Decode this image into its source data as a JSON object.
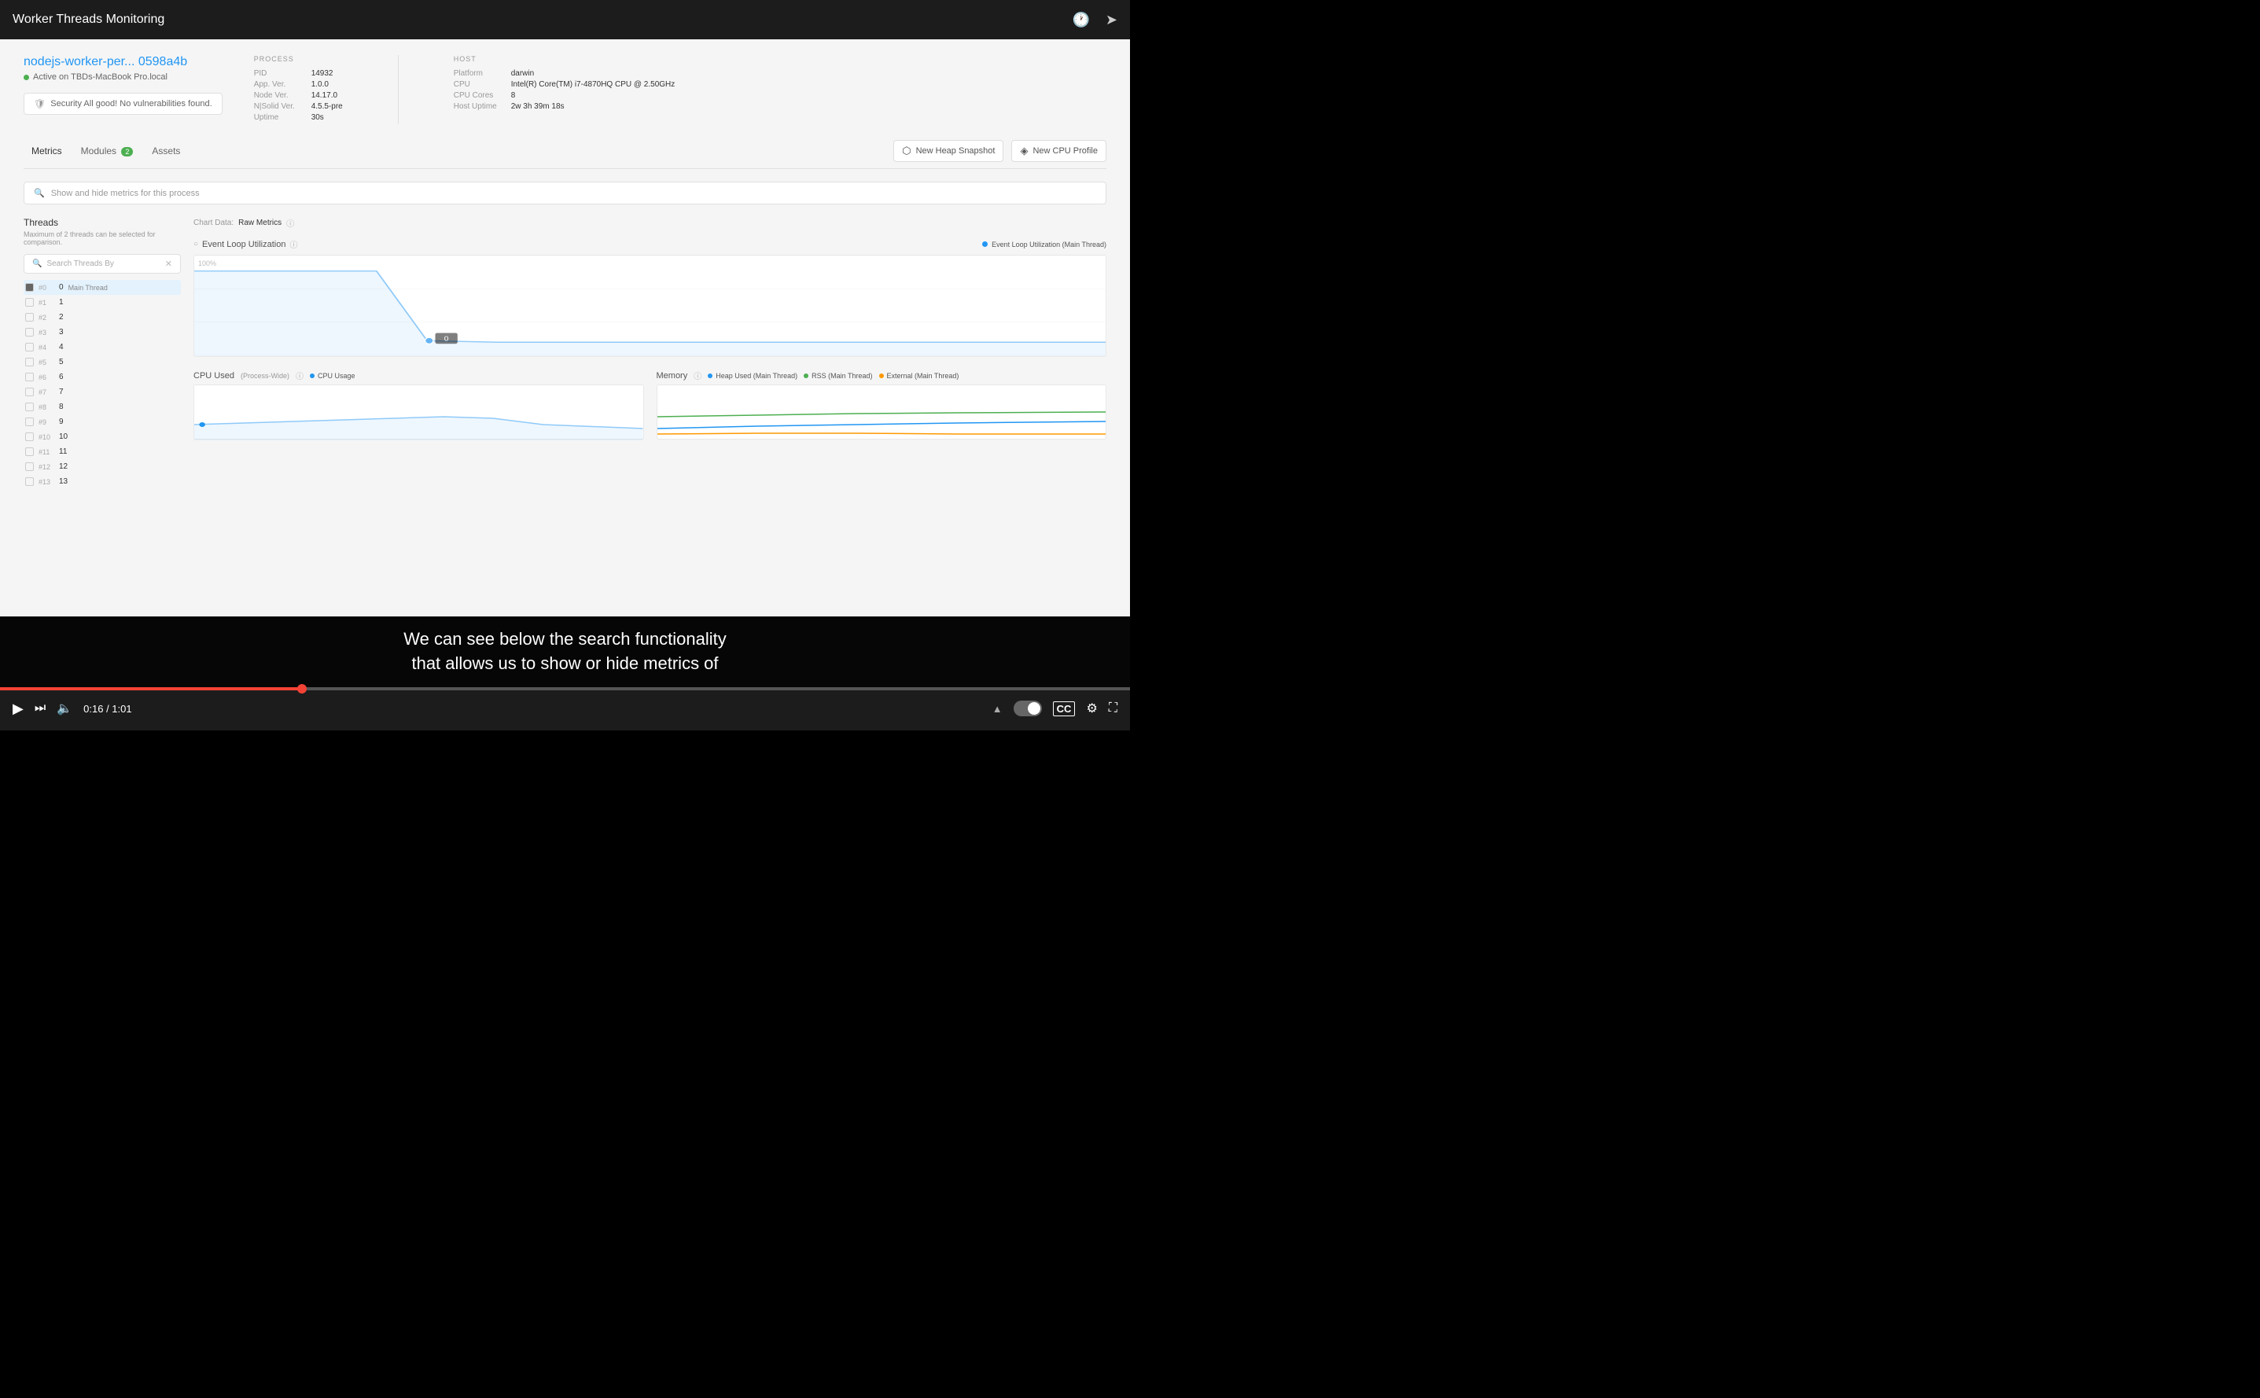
{
  "topBar": {
    "title": "Worker Threads Monitoring",
    "clockIcon": "🕐",
    "shareIcon": "➤"
  },
  "app": {
    "processName": "nodejs-worker-per...",
    "processId": "0598a4b",
    "activeOn": "Active on TBDs-MacBook Pro.local",
    "security": {
      "icon": "🛡",
      "text": "Security All good! No vulnerabilities found."
    },
    "process": {
      "sectionTitle": "PROCESS",
      "rows": [
        {
          "label": "PID",
          "value": "14932"
        },
        {
          "label": "App. Ver.",
          "value": "1.0.0"
        },
        {
          "label": "Node Ver.",
          "value": "14.17.0"
        },
        {
          "label": "N|Solid Ver.",
          "value": "4.5.5-pre"
        },
        {
          "label": "Uptime",
          "value": "30s"
        }
      ]
    },
    "host": {
      "sectionTitle": "HOST",
      "rows": [
        {
          "label": "Platform",
          "value": "darwin"
        },
        {
          "label": "CPU",
          "value": "Intel(R) Core(TM) i7-4870HQ CPU @ 2.50GHz"
        },
        {
          "label": "CPU Cores",
          "value": "8"
        },
        {
          "label": "Host Uptime",
          "value": "2w 3h 39m 18s"
        }
      ]
    },
    "tabs": [
      {
        "label": "Metrics",
        "active": true,
        "badge": null
      },
      {
        "label": "Modules",
        "active": false,
        "badge": "2"
      },
      {
        "label": "Assets",
        "active": false,
        "badge": null
      }
    ],
    "actionButtons": [
      {
        "icon": "📷",
        "label": "New Heap Snapshot"
      },
      {
        "icon": "📊",
        "label": "New CPU Profile"
      }
    ],
    "searchPlaceholder": "Show and hide metrics for this process",
    "threads": {
      "title": "Threads",
      "subtitle": "Maximum of 2 threads can be selected for comparison.",
      "searchPlaceholder": "Search Threads By",
      "items": [
        {
          "id": "0",
          "label": "Main Thread",
          "highlighted": true,
          "checked": true
        },
        {
          "id": "1",
          "label": "",
          "highlighted": false,
          "checked": false
        },
        {
          "id": "2",
          "label": "",
          "highlighted": false,
          "checked": false
        },
        {
          "id": "3",
          "label": "",
          "highlighted": false,
          "checked": false
        },
        {
          "id": "4",
          "label": "",
          "highlighted": false,
          "checked": false
        },
        {
          "id": "5",
          "label": "",
          "highlighted": false,
          "checked": false
        },
        {
          "id": "6",
          "label": "",
          "highlighted": false,
          "checked": false
        },
        {
          "id": "7",
          "label": "",
          "highlighted": false,
          "checked": false
        },
        {
          "id": "8",
          "label": "",
          "highlighted": false,
          "checked": false
        },
        {
          "id": "9",
          "label": "",
          "highlighted": false,
          "checked": false
        },
        {
          "id": "10",
          "label": "",
          "highlighted": false,
          "checked": false
        },
        {
          "id": "11",
          "label": "",
          "highlighted": false,
          "checked": false
        },
        {
          "id": "12",
          "label": "",
          "highlighted": false,
          "checked": false
        },
        {
          "id": "13",
          "label": "",
          "highlighted": false,
          "checked": false
        }
      ]
    },
    "chartData": {
      "label": "Chart Data:",
      "value": "Raw Metrics"
    },
    "eventLoop": {
      "title": "Event Loop Utilization",
      "legend": "Event Loop Utilization (Main Thread)",
      "yLabel": "100%"
    },
    "cpuUsed": {
      "title": "CPU Used",
      "subtitle": "(Process-Wide)",
      "legend": "CPU Usage"
    },
    "memory": {
      "title": "Memory",
      "legends": [
        "Heap Used (Main Thread)",
        "RSS (Main Thread)",
        "External (Main Thread)"
      ]
    }
  },
  "subtitle": {
    "line1": "We can see below the search functionality",
    "line2": "that allows us to show or hide metrics of"
  },
  "controls": {
    "playIcon": "▶",
    "nextIcon": "⏭",
    "volumeIcon": "🔊",
    "time": "0:16 / 1:01",
    "captionsIcon": "CC",
    "settingsIcon": "⚙",
    "fullscreenIcon": "⛶"
  },
  "progressBar": {
    "fillPercent": 26.7
  }
}
